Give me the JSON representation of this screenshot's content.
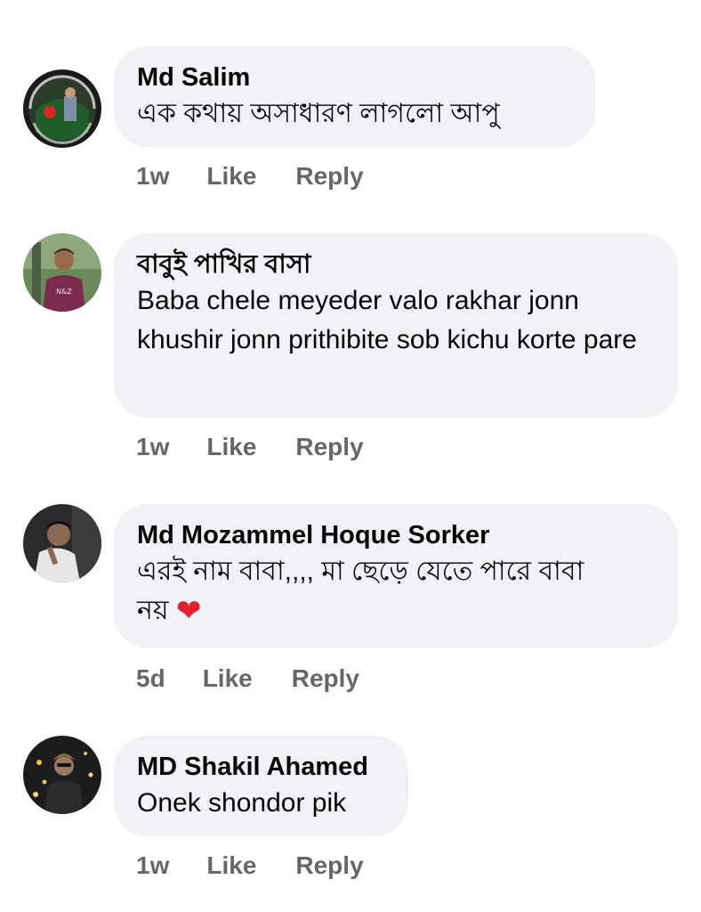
{
  "comments": [
    {
      "author": "Md Salim",
      "text": "এক কথায় অসাধারণ লাগলো আপু",
      "time": "1w",
      "like_label": "Like",
      "reply_label": "Reply"
    },
    {
      "author": "বাবুই পাখির বাসা",
      "text": "Baba chele meyeder valo rakhar jonn khushir jonn prithibite sob kichu korte pare",
      "time": "1w",
      "like_label": "Like",
      "reply_label": "Reply"
    },
    {
      "author": "Md Mozammel Hoque Sorker",
      "text": "এরই নাম বাবা,,,, মা ছেড়ে যেতে পারে বাবা নয়",
      "emoji": "❤",
      "time": "5d",
      "like_label": "Like",
      "reply_label": "Reply"
    },
    {
      "author": "MD Shakil Ahamed",
      "text": "Onek shondor pik",
      "time": "1w",
      "like_label": "Like",
      "reply_label": "Reply"
    }
  ],
  "colors": {
    "bubble": "#f0f2f5",
    "author": "#050505",
    "meta": "#65676b",
    "heart": "#e0202a"
  },
  "icons": [
    "avatar-md-salim",
    "avatar-babui-pakhir-basa",
    "avatar-md-mozammel",
    "avatar-md-shakil",
    "red-heart-emoji"
  ]
}
